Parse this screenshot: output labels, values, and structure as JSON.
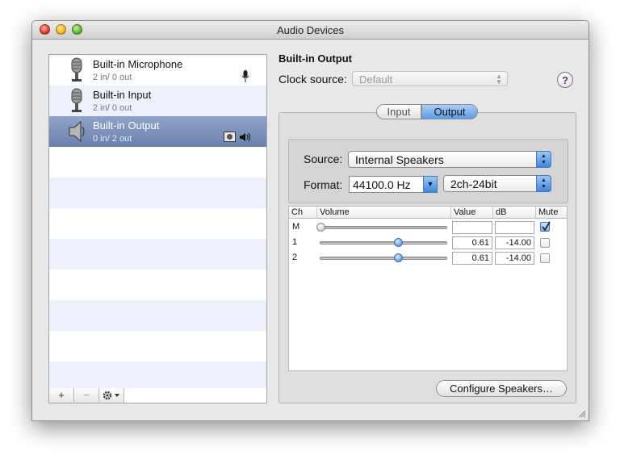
{
  "window": {
    "title": "Audio Devices"
  },
  "devices": [
    {
      "name": "Built-in Microphone",
      "io": "2 in/ 0 out",
      "icon": "microphone-icon"
    },
    {
      "name": "Built-in Input",
      "io": "2 in/ 0 out",
      "icon": "microphone-icon"
    },
    {
      "name": "Built-in Output",
      "io": "0 in/ 2 out",
      "icon": "speaker-icon",
      "selected": true
    }
  ],
  "list_toolbar": {
    "add": "+",
    "remove": "−"
  },
  "detail": {
    "header": "Built-in Output",
    "clock_label": "Clock source:",
    "clock_value": "Default",
    "tabs": [
      "Input",
      "Output"
    ],
    "active_tab": "Output",
    "source_label": "Source:",
    "source_value": "Internal Speakers",
    "format_label": "Format:",
    "format_rate": "44100.0 Hz",
    "format_bits": "2ch-24bit",
    "columns": [
      "Ch",
      "Volume",
      "Value",
      "dB",
      "Mute"
    ],
    "channels": [
      {
        "ch": "M",
        "value": "",
        "db": "",
        "mute": true,
        "level": 0
      },
      {
        "ch": "1",
        "value": "0.61",
        "db": "-14.00",
        "mute": false,
        "level": 0.61
      },
      {
        "ch": "2",
        "value": "0.61",
        "db": "-14.00",
        "mute": false,
        "level": 0.61
      }
    ],
    "configure_button": "Configure Speakers…"
  },
  "colors": {
    "selection": "#7388b3",
    "accent": "#5a9ce6",
    "help": "#5a2c8a"
  }
}
